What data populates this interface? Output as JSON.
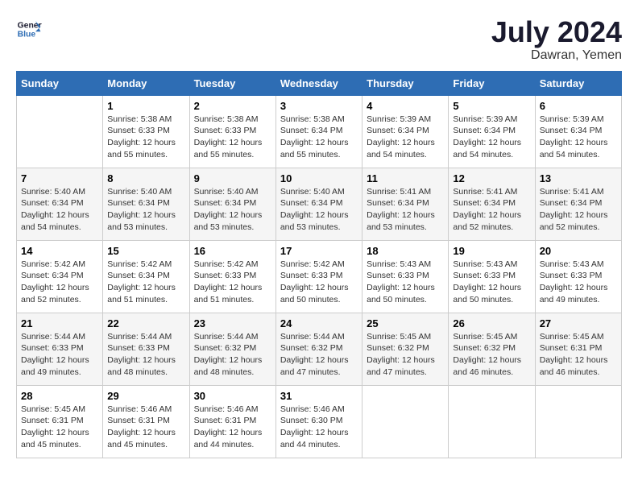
{
  "header": {
    "logo_line1": "General",
    "logo_line2": "Blue",
    "month_year": "July 2024",
    "location": "Dawran, Yemen"
  },
  "weekdays": [
    "Sunday",
    "Monday",
    "Tuesday",
    "Wednesday",
    "Thursday",
    "Friday",
    "Saturday"
  ],
  "weeks": [
    [
      {
        "day": "",
        "sunrise": "",
        "sunset": "",
        "daylight": ""
      },
      {
        "day": "1",
        "sunrise": "5:38 AM",
        "sunset": "6:33 PM",
        "daylight": "12 hours and 55 minutes."
      },
      {
        "day": "2",
        "sunrise": "5:38 AM",
        "sunset": "6:33 PM",
        "daylight": "12 hours and 55 minutes."
      },
      {
        "day": "3",
        "sunrise": "5:38 AM",
        "sunset": "6:34 PM",
        "daylight": "12 hours and 55 minutes."
      },
      {
        "day": "4",
        "sunrise": "5:39 AM",
        "sunset": "6:34 PM",
        "daylight": "12 hours and 54 minutes."
      },
      {
        "day": "5",
        "sunrise": "5:39 AM",
        "sunset": "6:34 PM",
        "daylight": "12 hours and 54 minutes."
      },
      {
        "day": "6",
        "sunrise": "5:39 AM",
        "sunset": "6:34 PM",
        "daylight": "12 hours and 54 minutes."
      }
    ],
    [
      {
        "day": "7",
        "sunrise": "5:40 AM",
        "sunset": "6:34 PM",
        "daylight": "12 hours and 54 minutes."
      },
      {
        "day": "8",
        "sunrise": "5:40 AM",
        "sunset": "6:34 PM",
        "daylight": "12 hours and 53 minutes."
      },
      {
        "day": "9",
        "sunrise": "5:40 AM",
        "sunset": "6:34 PM",
        "daylight": "12 hours and 53 minutes."
      },
      {
        "day": "10",
        "sunrise": "5:40 AM",
        "sunset": "6:34 PM",
        "daylight": "12 hours and 53 minutes."
      },
      {
        "day": "11",
        "sunrise": "5:41 AM",
        "sunset": "6:34 PM",
        "daylight": "12 hours and 53 minutes."
      },
      {
        "day": "12",
        "sunrise": "5:41 AM",
        "sunset": "6:34 PM",
        "daylight": "12 hours and 52 minutes."
      },
      {
        "day": "13",
        "sunrise": "5:41 AM",
        "sunset": "6:34 PM",
        "daylight": "12 hours and 52 minutes."
      }
    ],
    [
      {
        "day": "14",
        "sunrise": "5:42 AM",
        "sunset": "6:34 PM",
        "daylight": "12 hours and 52 minutes."
      },
      {
        "day": "15",
        "sunrise": "5:42 AM",
        "sunset": "6:34 PM",
        "daylight": "12 hours and 51 minutes."
      },
      {
        "day": "16",
        "sunrise": "5:42 AM",
        "sunset": "6:33 PM",
        "daylight": "12 hours and 51 minutes."
      },
      {
        "day": "17",
        "sunrise": "5:42 AM",
        "sunset": "6:33 PM",
        "daylight": "12 hours and 50 minutes."
      },
      {
        "day": "18",
        "sunrise": "5:43 AM",
        "sunset": "6:33 PM",
        "daylight": "12 hours and 50 minutes."
      },
      {
        "day": "19",
        "sunrise": "5:43 AM",
        "sunset": "6:33 PM",
        "daylight": "12 hours and 50 minutes."
      },
      {
        "day": "20",
        "sunrise": "5:43 AM",
        "sunset": "6:33 PM",
        "daylight": "12 hours and 49 minutes."
      }
    ],
    [
      {
        "day": "21",
        "sunrise": "5:44 AM",
        "sunset": "6:33 PM",
        "daylight": "12 hours and 49 minutes."
      },
      {
        "day": "22",
        "sunrise": "5:44 AM",
        "sunset": "6:33 PM",
        "daylight": "12 hours and 48 minutes."
      },
      {
        "day": "23",
        "sunrise": "5:44 AM",
        "sunset": "6:32 PM",
        "daylight": "12 hours and 48 minutes."
      },
      {
        "day": "24",
        "sunrise": "5:44 AM",
        "sunset": "6:32 PM",
        "daylight": "12 hours and 47 minutes."
      },
      {
        "day": "25",
        "sunrise": "5:45 AM",
        "sunset": "6:32 PM",
        "daylight": "12 hours and 47 minutes."
      },
      {
        "day": "26",
        "sunrise": "5:45 AM",
        "sunset": "6:32 PM",
        "daylight": "12 hours and 46 minutes."
      },
      {
        "day": "27",
        "sunrise": "5:45 AM",
        "sunset": "6:31 PM",
        "daylight": "12 hours and 46 minutes."
      }
    ],
    [
      {
        "day": "28",
        "sunrise": "5:45 AM",
        "sunset": "6:31 PM",
        "daylight": "12 hours and 45 minutes."
      },
      {
        "day": "29",
        "sunrise": "5:46 AM",
        "sunset": "6:31 PM",
        "daylight": "12 hours and 45 minutes."
      },
      {
        "day": "30",
        "sunrise": "5:46 AM",
        "sunset": "6:31 PM",
        "daylight": "12 hours and 44 minutes."
      },
      {
        "day": "31",
        "sunrise": "5:46 AM",
        "sunset": "6:30 PM",
        "daylight": "12 hours and 44 minutes."
      },
      {
        "day": "",
        "sunrise": "",
        "sunset": "",
        "daylight": ""
      },
      {
        "day": "",
        "sunrise": "",
        "sunset": "",
        "daylight": ""
      },
      {
        "day": "",
        "sunrise": "",
        "sunset": "",
        "daylight": ""
      }
    ]
  ]
}
